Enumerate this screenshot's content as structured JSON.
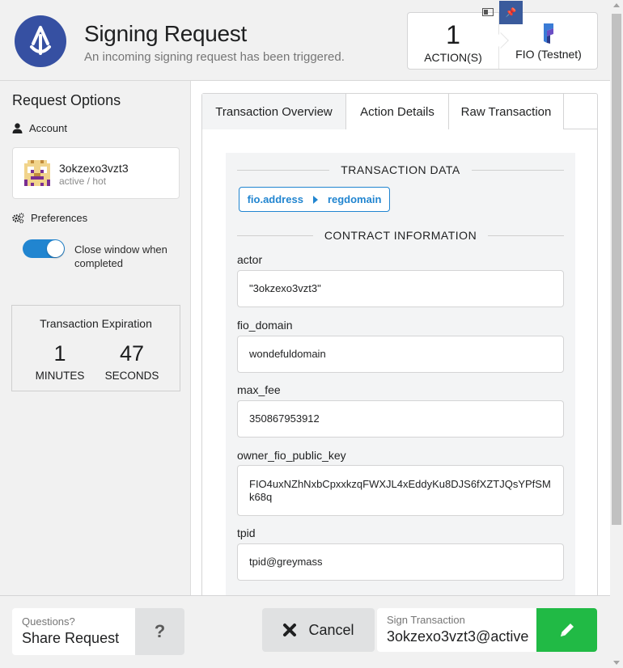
{
  "header": {
    "title": "Signing Request",
    "subtitle": "An incoming signing request has been triggered.",
    "action_count": "1",
    "action_label": "ACTION(S)",
    "chain_name": "FIO (Testnet)",
    "brand_color": "#3650a2"
  },
  "sidebar": {
    "title": "Request Options",
    "account_label": "Account",
    "account_name": "3okzexo3vzt3",
    "account_permission": "active / hot",
    "preferences_label": "Preferences",
    "close_window_toggle": {
      "label": "Close window when completed",
      "on": true
    },
    "expiration": {
      "title": "Transaction Expiration",
      "minutes": "1",
      "minutes_label": "MINUTES",
      "seconds": "47",
      "seconds_label": "SECONDS"
    }
  },
  "tabs": [
    {
      "label": "Transaction Overview",
      "active": true
    },
    {
      "label": "Action Details",
      "active": false
    },
    {
      "label": "Raw Transaction",
      "active": false
    }
  ],
  "transaction": {
    "data_heading": "TRANSACTION DATA",
    "contract": "fio.address",
    "action": "regdomain",
    "contract_heading": "CONTRACT INFORMATION",
    "fields": [
      {
        "label": "actor",
        "value": "\"3okzexo3vzt3\""
      },
      {
        "label": "fio_domain",
        "value": "wondefuldomain"
      },
      {
        "label": "max_fee",
        "value": "350867953912"
      },
      {
        "label": "owner_fio_public_key",
        "value": "FIO4uxNZhNxbCpxxkzqFWXJL4xEddyKu8DJS6fXZTJQsYPfSMk68q"
      },
      {
        "label": "tpid",
        "value": "tpid@greymass"
      }
    ]
  },
  "footer": {
    "share_small": "Questions?",
    "share_big": "Share Request",
    "help_icon": "?",
    "cancel_label": "Cancel",
    "sign_small": "Sign Transaction",
    "sign_account": "3okzexo3vzt3@active",
    "sign_color": "#21ba45"
  }
}
